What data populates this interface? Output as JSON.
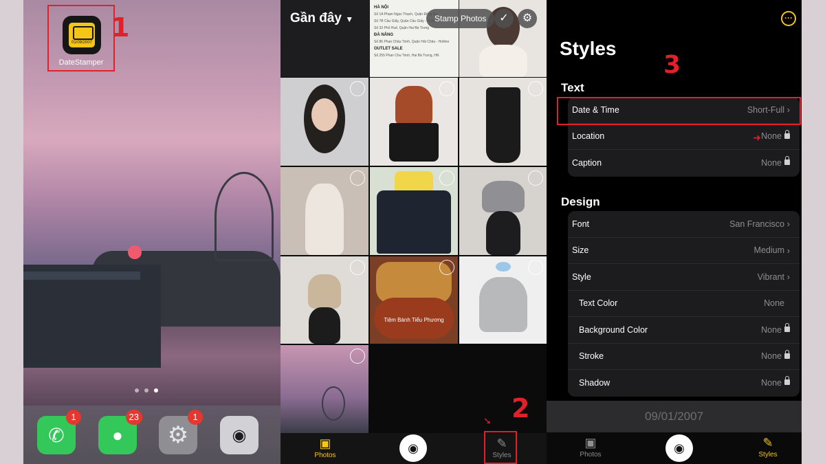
{
  "steps": {
    "one": "1",
    "two": "2",
    "three": "3"
  },
  "home": {
    "app": {
      "name": "DateStamper",
      "icon_date": "01/09/2007",
      "icon": "datestamper-app-icon"
    },
    "dock": [
      {
        "name": "phone-app",
        "icon": "phone-icon",
        "glyph": "✆",
        "color": "#34c759",
        "badge": "1"
      },
      {
        "name": "messages-app",
        "icon": "messages-icon",
        "glyph": "💬",
        "color": "#34c759",
        "badge": "23"
      },
      {
        "name": "settings-app",
        "icon": "gear-icon",
        "glyph": "⚙",
        "color": "#8e8e93",
        "badge": "1"
      },
      {
        "name": "camera-app",
        "icon": "camera-icon",
        "glyph": "📷",
        "color": "#c7c7cc",
        "badge": ""
      }
    ]
  },
  "photos": {
    "album_title": "Gần đây",
    "stamp_button": "Stamp Photos",
    "doc_lines": [
      "HÀ NỘI",
      "Số 1A Phạm Ngọc Thạch, Quận Đống Đa",
      "Số 7B Cầu Giấy, Quận Cầu Giấy - Hotline 0247",
      "Số 33 Phố Huế, Quận Hai Bà Trưng",
      "ĐÀ NẴNG",
      "Số 86 Phan Châu Trinh, Quận Hải Châu - Hotline",
      "OUTLET SALE",
      "Số 255 Phan Chu Trinh, Hai Bà Trưng, HN"
    ],
    "food_caption": "Tiệm Bánh Tiểu Phương",
    "tabs": {
      "photos": "Photos",
      "styles": "Styles"
    }
  },
  "styles": {
    "title": "Styles",
    "text_section": "Text",
    "design_section": "Design",
    "text_rows": [
      {
        "label": "Date & Time",
        "value": "Short-Full"
      },
      {
        "label": "Location",
        "value": "None"
      },
      {
        "label": "Caption",
        "value": "None"
      }
    ],
    "design_rows": [
      {
        "label": "Font",
        "value": "San Francisco"
      },
      {
        "label": "Size",
        "value": "Medium"
      },
      {
        "label": "Style",
        "value": "Vibrant"
      },
      {
        "label": "Text Color",
        "value": "None"
      },
      {
        "label": "Background Color",
        "value": "None"
      },
      {
        "label": "Stroke",
        "value": "None"
      },
      {
        "label": "Shadow",
        "value": "None"
      }
    ],
    "preview_date": "09/01/2007",
    "tabs": {
      "photos": "Photos",
      "styles": "Styles"
    },
    "accent": "#f5c518"
  },
  "colors": {
    "highlight": "#e0212a",
    "accent": "#f5c518"
  }
}
